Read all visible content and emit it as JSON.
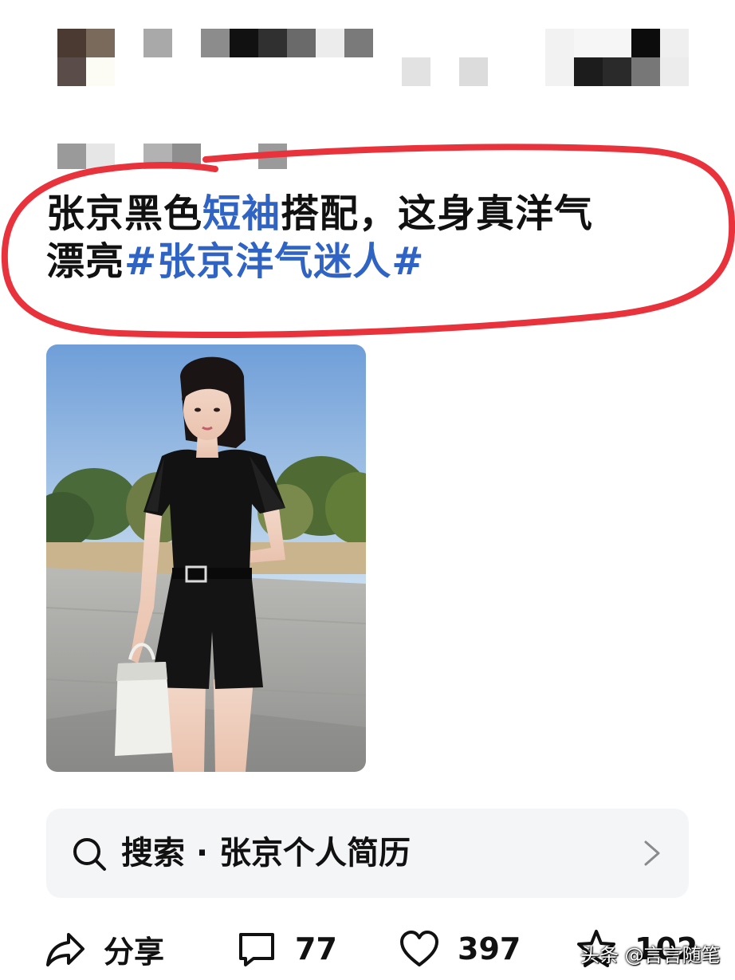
{
  "post": {
    "title_line1_a": "张京黑色",
    "title_line1_b": "短袖",
    "title_line1_c": "搭配，这身真洋气",
    "title_line2_a": "漂亮",
    "title_line2_hashtag": "#张京洋气迷人#"
  },
  "search": {
    "prefix": "搜索",
    "separator": " · ",
    "query": "张京个人简历"
  },
  "actions": {
    "share_label": "分享",
    "comment_count": "77",
    "like_count": "397",
    "favorite_count": "102"
  },
  "watermark": "头条 @言言随笔",
  "colors": {
    "link_blue": "#2f63c4",
    "highlight_ring": "#e8323c",
    "card_bg": "#f4f5f7"
  }
}
